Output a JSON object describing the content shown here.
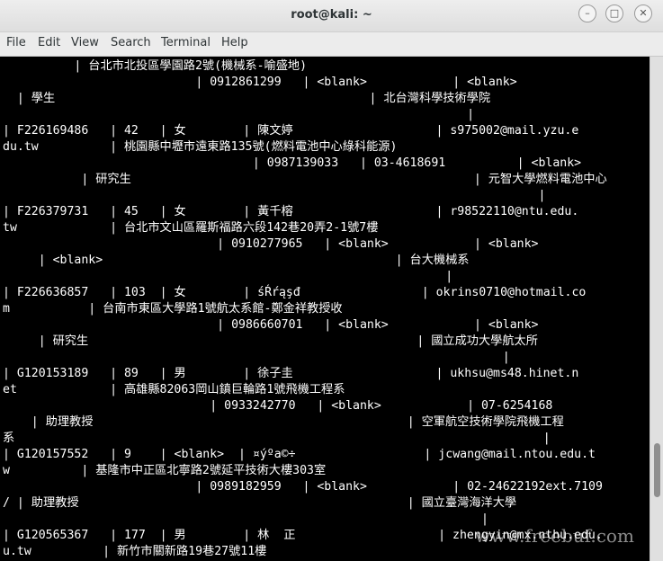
{
  "window": {
    "title": "root@kali: ~",
    "minimize_glyph": "–",
    "maximize_glyph": "□",
    "close_glyph": "✕"
  },
  "menu": {
    "file": "File",
    "edit": "Edit",
    "view": "View",
    "search": "Search",
    "terminal": "Terminal",
    "help": "Help"
  },
  "terminal": {
    "lines": [
      "          | 台北市北投區學園路2號(機械系-喻盛地)",
      "                           | 0912861299   | <blank>            | <blank>",
      "  | 學生                                            | 北台灣科學技術學院",
      "                                                                 |",
      "| F226169486   | 42   | 女        | 陳文婷                    | s975002@mail.yzu.e",
      "du.tw          | 桃園縣中壢市遠東路135號(燃料電池中心綠科能源)",
      "                                   | 0987139033   | 03-4618691          | <blank>",
      "           | 研究生                                                | 元智大學燃料電池中心",
      "                                                                           |",
      "| F226379731   | 45   | 女        | 黃千榕                    | r98522110@ntu.edu.",
      "tw             | 台北市文山區羅斯福路六段142巷20弄2-1號7樓",
      "                              | 0910277965   | <blank>            | <blank>",
      "     | <blank>                                         | 台大機械系",
      "                                                              |",
      "| F226636857   | 103  | 女        | śŔŕąşđ                 | okrins0710@hotmail.co",
      "m           | 台南市東區大學路1號航太系館-鄭金祥教授收",
      "                              | 0986660701   | <blank>            | <blank>",
      "     | 研究生                                              | 國立成功大學航太所",
      "                                                                      |",
      "| G120153189   | 89   | 男        | 徐子圭                    | ukhsu@ms48.hinet.n",
      "et             | 高雄縣82063岡山鎮巨輪路1號飛機工程系",
      "                             | 0933242770   | <blank>            | 07-6254168",
      "    | 助理教授                                            | 空軍航空技術學院飛機工程",
      "系                                                                          |",
      "| G120157552   | 9    | <blank>  | ¤ýºa©÷                  | jcwang@mail.ntou.edu.t",
      "w          | 基隆市中正區北寧路2號延平技術大樓303室",
      "                           | 0989182959   | <blank>            | 02-24622192ext.7109",
      "/ | 助理教授                                              | 國立臺灣海洋大學",
      "                                                                   |",
      "| G120565367   | 177  | 男        | 林  正                    | zhengyin@mx.nthu.edu.",
      "u.tw          | 新竹市關新路19巷27號11樓"
    ]
  },
  "watermark": {
    "text": "www.freebuf.com"
  }
}
